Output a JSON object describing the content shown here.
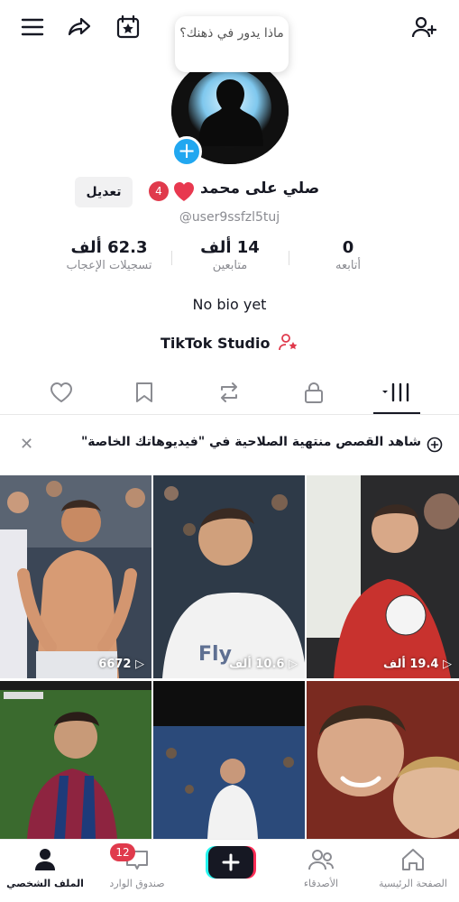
{
  "bubble": {
    "text": "ماذا يدور في ذهنك؟"
  },
  "profile": {
    "name": "صلي على محمد",
    "badge_count": "4",
    "handle": "@user9ssfzl5tuj",
    "edit_label": "تعديل",
    "bio": "No bio yet",
    "studio_label": "TikTok Studio"
  },
  "stats": {
    "following": {
      "value": "0",
      "label": "أتابعه"
    },
    "followers": {
      "value": "14 ألف",
      "label": "متابعين"
    },
    "likes": {
      "value": "62.3 ألف",
      "label": "تسجيلات الإعجاب"
    }
  },
  "banner": {
    "text": "شاهد القصص منتهية الصلاحية في \"فيديوهاتك الخاصة\""
  },
  "videos": [
    {
      "views": "6672"
    },
    {
      "views": "10.6 ألف"
    },
    {
      "views": "19.4 ألف"
    },
    {
      "views": ""
    },
    {
      "views": ""
    },
    {
      "views": ""
    }
  ],
  "nav": {
    "home": "الصفحة الرئيسية",
    "friends": "الأصدقاء",
    "inbox": "صندوق الوارد",
    "inbox_badge": "12",
    "profile": "الملف الشخصي"
  },
  "colors": {
    "accent": "#e03a4c",
    "blue": "#21a7f0",
    "text": "#161823"
  }
}
